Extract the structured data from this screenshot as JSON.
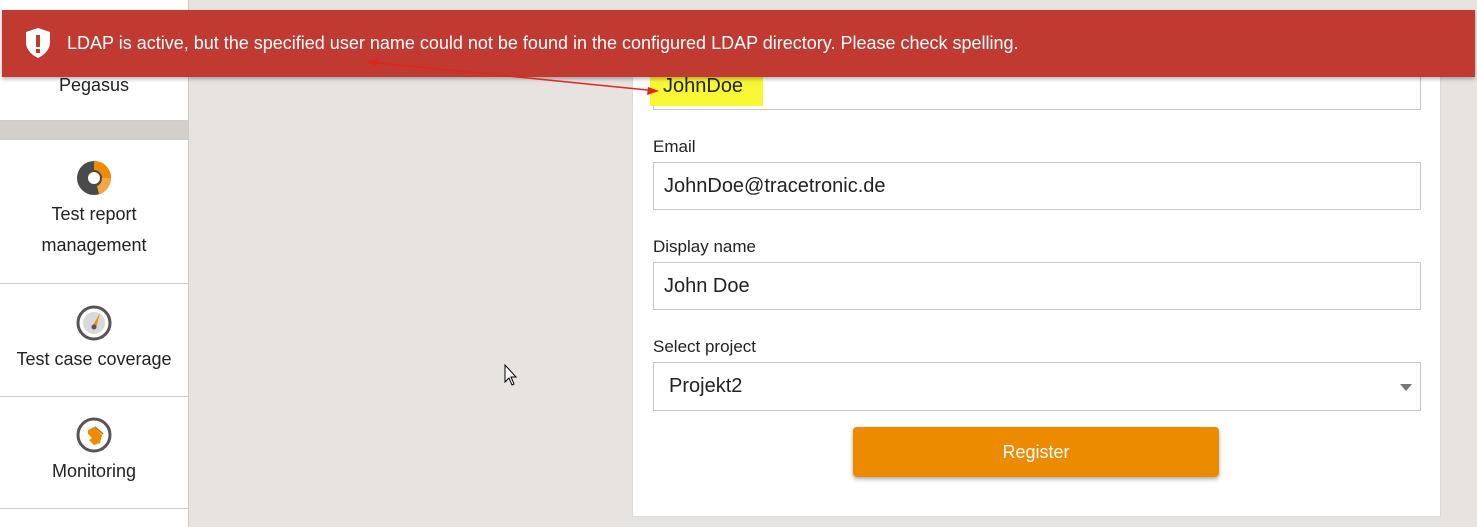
{
  "sidebar": {
    "items": [
      {
        "label": "Pegasus",
        "icon": "pegasus-icon"
      },
      {
        "label_line1": "Test report",
        "label_line2": "management",
        "icon": "test-report-icon"
      },
      {
        "label": "Test case coverage",
        "icon": "gauge-icon"
      },
      {
        "label": "Monitoring",
        "icon": "monitoring-hand-icon"
      }
    ]
  },
  "alert": {
    "message": "LDAP is active, but the specified user name could not be found in the configured LDAP directory. Please check spelling.",
    "icon": "shield-alert-icon",
    "color": "#c03a32"
  },
  "form": {
    "username_value": "JohnDoe",
    "email_label": "Email",
    "email_value": "JohnDoe@tracetronic.de",
    "display_name_label": "Display name",
    "display_name_value": "John Doe",
    "project_label": "Select project",
    "project_value": "Projekt2",
    "register_label": "Register",
    "accent_color": "#ec8a00",
    "highlight_color": "#f7f734"
  }
}
